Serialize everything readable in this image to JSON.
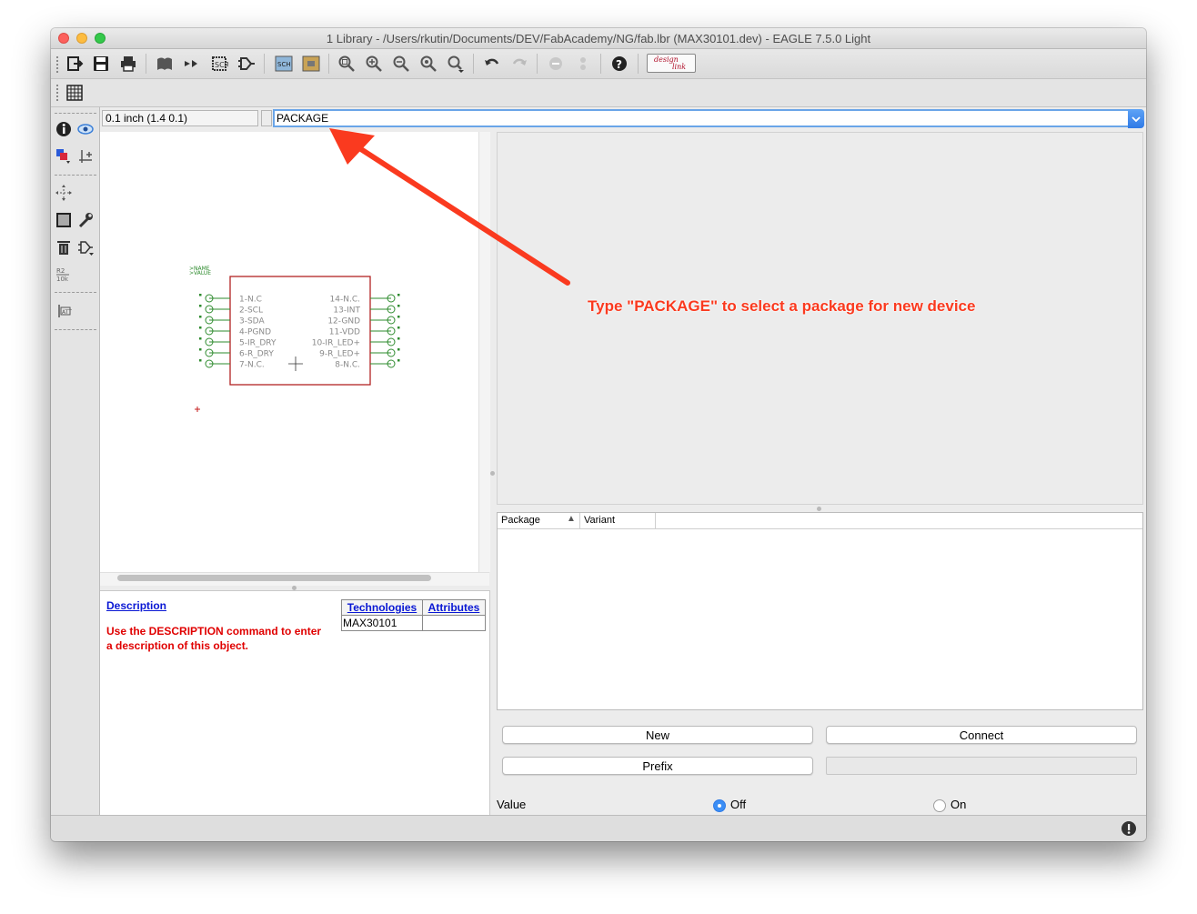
{
  "window": {
    "title": "1 Library - /Users/rkutin/Documents/DEV/FabAcademy/NG/fab.lbr (MAX30101.dev) - EAGLE 7.5.0 Light"
  },
  "toolbar": {
    "designlink_line1": "design",
    "designlink_line2": "link",
    "icons": [
      "open-icon",
      "save-icon",
      "print-icon",
      "library-icon",
      "cam-icon",
      "script-icon",
      "ulp-icon",
      "sch-icon",
      "brd-icon",
      "zoom-fit-icon",
      "zoom-in-icon",
      "zoom-out-icon",
      "zoom-redraw-icon",
      "zoom-select-icon",
      "undo-icon",
      "redo-icon",
      "stop-icon",
      "go-icon",
      "help-icon"
    ]
  },
  "command_bar": {
    "coordinates": "0.1 inch (1.4 0.1)",
    "command": "PACKAGE"
  },
  "schematic": {
    "name_label": ">NAME",
    "value_label": ">VALUE",
    "left_pins": [
      "1-N.C",
      "2-SCL",
      "3-SDA",
      "4-PGND",
      "5-IR_DRY",
      "6-R_DRY",
      "7-N.C."
    ],
    "right_pins": [
      "14-N.C.",
      "13-INT",
      "12-GND",
      "11-VDD",
      "10-IR_LED+",
      "9-R_LED+",
      "8-N.C."
    ]
  },
  "description": {
    "link": "Description",
    "text": "Use the DESCRIPTION command to enter a description of this object."
  },
  "technologies": {
    "headers": [
      "Technologies",
      "Attributes"
    ],
    "rows": [
      [
        "MAX30101",
        ""
      ]
    ]
  },
  "package_list": {
    "columns": [
      "Package",
      "Variant"
    ],
    "sort_indicator": "▲"
  },
  "buttons": {
    "new": "New",
    "connect": "Connect",
    "prefix": "Prefix"
  },
  "value_option": {
    "label": "Value",
    "off": "Off",
    "on": "On",
    "selected": "Off"
  },
  "annotation": {
    "text": "Type \"PACKAGE\" to select a package for new device",
    "color": "#fa3a1f"
  },
  "colors": {
    "symbol_body": "#b22222",
    "pin": "#2e8b2e",
    "accent": "#3b8ef5"
  }
}
